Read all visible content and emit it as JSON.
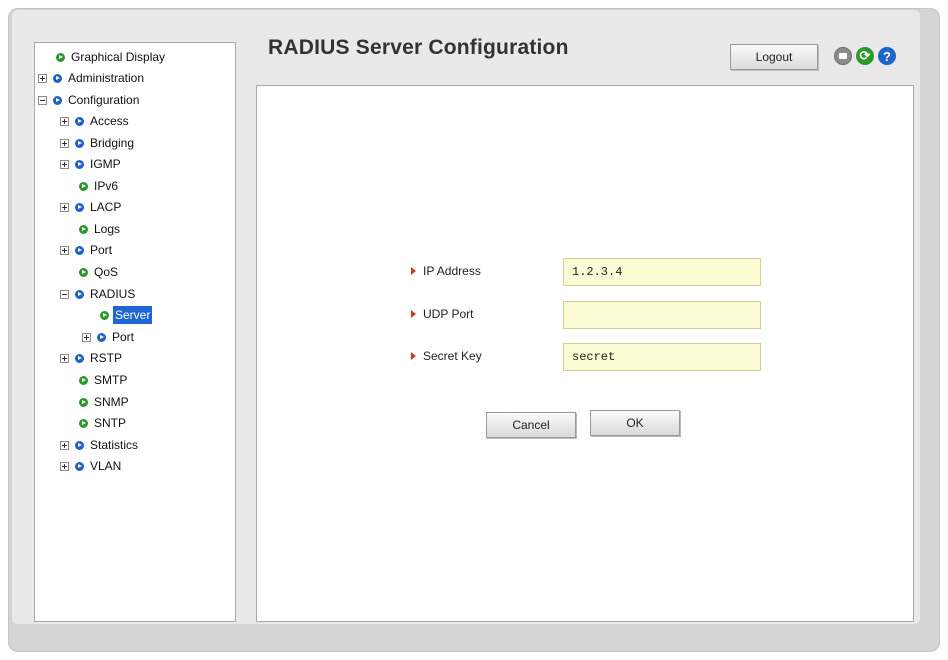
{
  "header": {
    "title": "RADIUS Server Configuration",
    "logout_label": "Logout"
  },
  "icons": {
    "save": "save-icon",
    "refresh": "refresh-icon",
    "help": "help-icon",
    "help_glyph": "?",
    "refresh_glyph": "⟳"
  },
  "tree": {
    "items": [
      {
        "label": "Graphical Display"
      },
      {
        "label": "Administration"
      },
      {
        "label": "Configuration"
      },
      {
        "label": "Access"
      },
      {
        "label": "Bridging"
      },
      {
        "label": "IGMP"
      },
      {
        "label": "IPv6"
      },
      {
        "label": "LACP"
      },
      {
        "label": "Logs"
      },
      {
        "label": "Port"
      },
      {
        "label": "QoS"
      },
      {
        "label": "RADIUS"
      },
      {
        "label": "Server"
      },
      {
        "label": "Port"
      },
      {
        "label": "RSTP"
      },
      {
        "label": "SMTP"
      },
      {
        "label": "SNMP"
      },
      {
        "label": "SNTP"
      },
      {
        "label": "Statistics"
      },
      {
        "label": "VLAN"
      }
    ],
    "selected": "Server"
  },
  "form": {
    "ip_address": {
      "label": "IP Address",
      "value": "1.2.3.4"
    },
    "udp_port": {
      "label": "UDP Port",
      "value": ""
    },
    "secret_key": {
      "label": "Secret Key",
      "value": "secret"
    },
    "cancel_label": "Cancel",
    "ok_label": "OK"
  },
  "colors": {
    "bullet_blue": "#1f61c9",
    "bullet_green": "#2b9a2b",
    "selection": "#1e66d6",
    "input_fill": "#fdfbd4",
    "label_arrow": "#c0411e"
  }
}
